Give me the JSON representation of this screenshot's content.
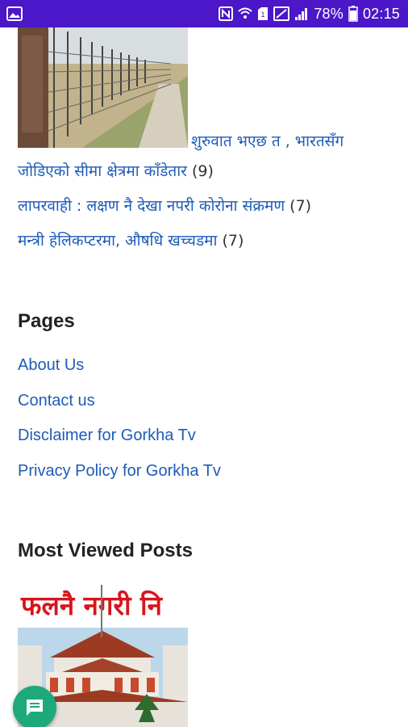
{
  "status_bar": {
    "battery_percent": "78%",
    "time": "02:15",
    "icons": [
      "gallery-icon",
      "nfc-icon",
      "wifi-icon",
      "sim-icon",
      "data-icon",
      "signal-icon",
      "battery-icon"
    ]
  },
  "recent_posts": [
    {
      "title": "शुरुवात भएछ त , भारतसँग",
      "title_cont": "जोडिएको सीमा क्षेत्रमा काँडेतार",
      "count": "(9)"
    },
    {
      "title": "लापरवाही : लक्षण नै देखा नपरी कोरोना संक्रमण",
      "count": "(7)"
    },
    {
      "title": "मन्त्री हेलिकप्टरमा, औषधि खच्चडमा",
      "count": "(7)"
    }
  ],
  "pages_section": {
    "title": "Pages",
    "links": [
      "About Us",
      "Contact us",
      "Disclaimer for Gorkha Tv",
      "Privacy Policy for Gorkha Tv"
    ]
  },
  "most_viewed": {
    "title": "Most Viewed Posts",
    "thumb_text": "फलनै नगरी नि"
  },
  "colors": {
    "status_bar": "#4b17c8",
    "link": "#1e5bb8",
    "fab": "#1ea97c"
  }
}
